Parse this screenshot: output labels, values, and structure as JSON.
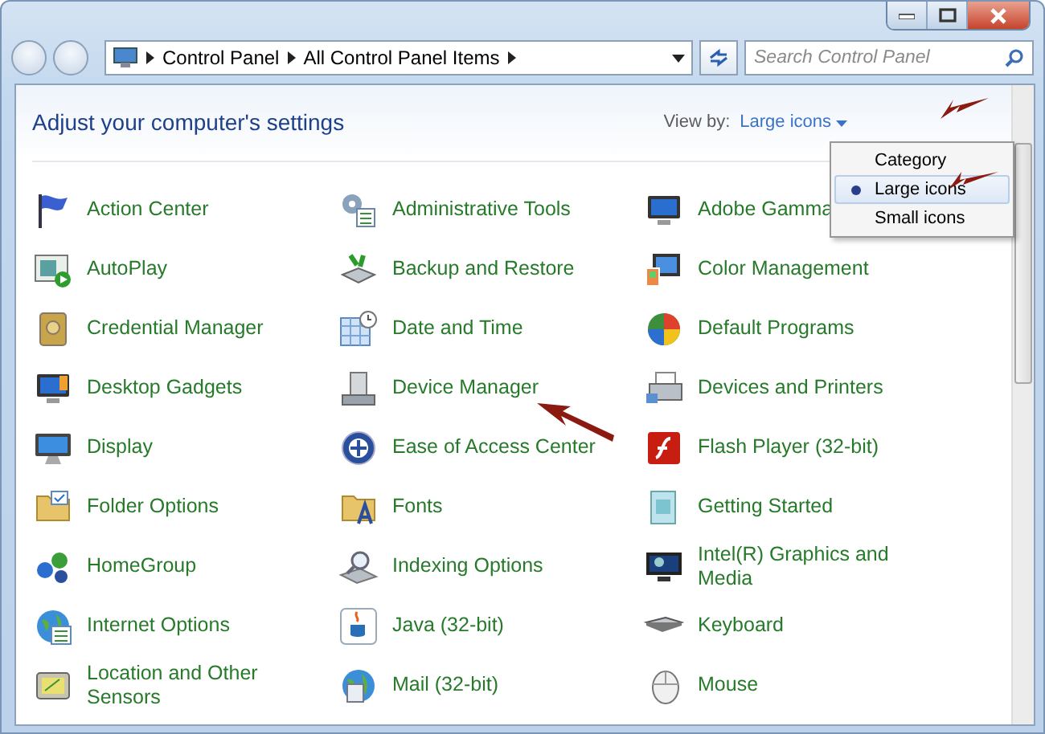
{
  "navigation": {
    "breadcrumbs": [
      "Control Panel",
      "All Control Panel Items"
    ],
    "search": {
      "placeholder": "Search Control Panel"
    }
  },
  "heading": "Adjust your computer's settings",
  "view_by": {
    "label": "View by:",
    "value": "Large icons",
    "menu": [
      {
        "label": "Category",
        "selected": false
      },
      {
        "label": "Large icons",
        "selected": true
      },
      {
        "label": "Small icons",
        "selected": false
      }
    ]
  },
  "items": [
    {
      "label": "Action Center"
    },
    {
      "label": "Administrative Tools"
    },
    {
      "label": "Adobe Gamma"
    },
    {
      "label": "AutoPlay"
    },
    {
      "label": "Backup and Restore"
    },
    {
      "label": "Color Management"
    },
    {
      "label": "Credential Manager"
    },
    {
      "label": "Date and Time"
    },
    {
      "label": "Default Programs"
    },
    {
      "label": "Desktop Gadgets"
    },
    {
      "label": "Device Manager"
    },
    {
      "label": "Devices and Printers"
    },
    {
      "label": "Display"
    },
    {
      "label": "Ease of Access Center"
    },
    {
      "label": "Flash Player (32-bit)"
    },
    {
      "label": "Folder Options"
    },
    {
      "label": "Fonts"
    },
    {
      "label": "Getting Started"
    },
    {
      "label": "HomeGroup"
    },
    {
      "label": "Indexing Options"
    },
    {
      "label": "Intel(R) Graphics and Media"
    },
    {
      "label": "Internet Options"
    },
    {
      "label": "Java (32-bit)"
    },
    {
      "label": "Keyboard"
    },
    {
      "label": "Location and Other Sensors"
    },
    {
      "label": "Mail (32-bit)"
    },
    {
      "label": "Mouse"
    }
  ]
}
